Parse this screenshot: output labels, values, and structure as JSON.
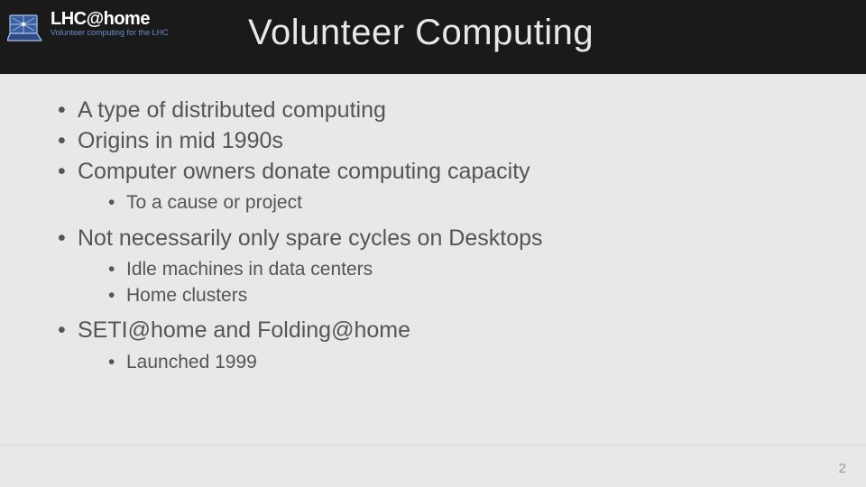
{
  "header": {
    "logo_main": "LHC@home",
    "logo_sub": "Volunteer computing for the LHC",
    "title": "Volunteer Computing"
  },
  "bullets": [
    {
      "text": "A type of distributed computing"
    },
    {
      "text": "Origins in mid 1990s"
    },
    {
      "text": "Computer owners donate computing capacity",
      "sub": [
        {
          "text": "To a cause or project"
        }
      ]
    },
    {
      "text": "Not necessarily only spare cycles on Desktops",
      "sub": [
        {
          "text": "Idle machines in data centers"
        },
        {
          "text": "Home clusters"
        }
      ]
    },
    {
      "text": "SETI@home and Folding@home",
      "sub": [
        {
          "text": "Launched 1999"
        }
      ]
    }
  ],
  "page_number": "2"
}
